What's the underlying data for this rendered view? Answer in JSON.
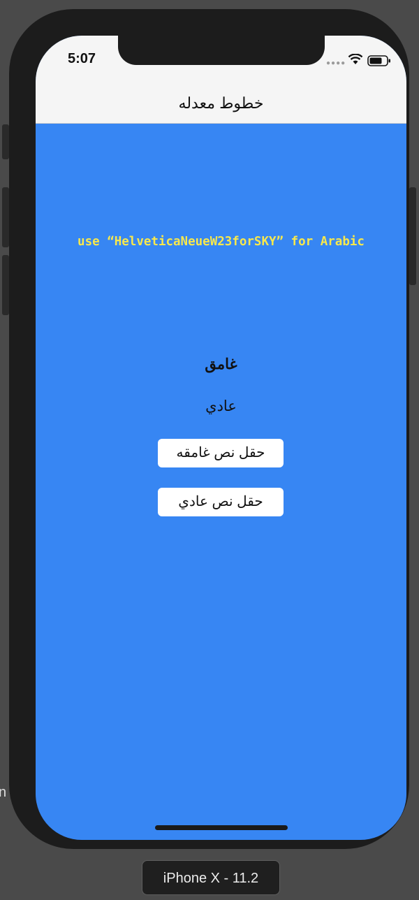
{
  "status_bar": {
    "time": "5:07",
    "signal_icon": "cellular-dots-icon",
    "wifi_icon": "wifi-icon",
    "battery_icon": "battery-icon"
  },
  "nav": {
    "title": "خطوط معدله"
  },
  "content": {
    "hint": "use “HelveticaNeueW23forSKY” for Arabic",
    "bold_label": "غامق",
    "regular_label": "عادي",
    "bold_field_value": "حقل نص غامقه",
    "regular_field_value": "حقل نص عادي"
  },
  "colors": {
    "screen_background": "#3786f3",
    "hint_text": "#f7e84d",
    "nav_background": "#f5f5f5"
  },
  "simulator": {
    "device_label": "iPhone X - 11.2",
    "left_edge_fragment": "n"
  }
}
